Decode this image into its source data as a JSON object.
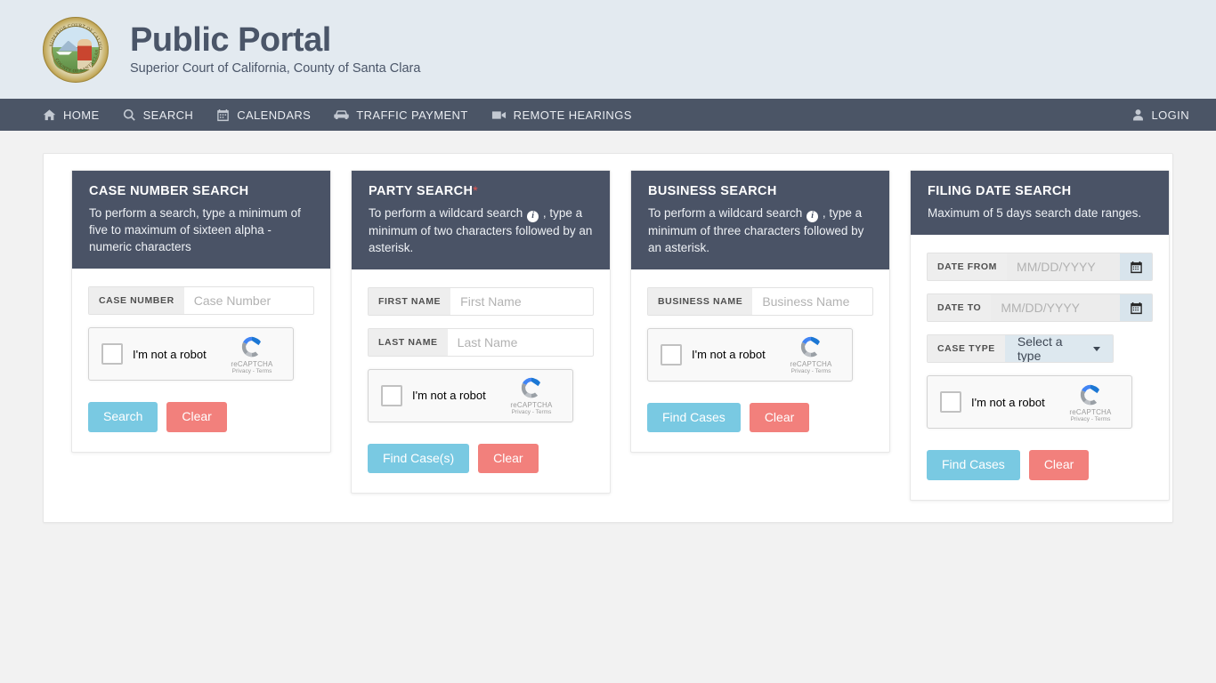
{
  "header": {
    "logo_alt": "court-seal",
    "title": "Public Portal",
    "subtitle": "Superior Court of California, County of Santa Clara",
    "background_color": "#e3eaf0",
    "title_color": "#4a5568"
  },
  "navbar": {
    "background_color": "#4b5566",
    "items": [
      {
        "label": "HOME",
        "icon": "home-icon"
      },
      {
        "label": "SEARCH",
        "icon": "search-icon"
      },
      {
        "label": "CALENDARS",
        "icon": "calendar-icon"
      },
      {
        "label": "TRAFFIC PAYMENT",
        "icon": "car-icon"
      },
      {
        "label": "REMOTE HEARINGS",
        "icon": "video-camera-icon"
      }
    ],
    "login": {
      "label": "LOGIN",
      "icon": "user-icon"
    }
  },
  "recaptcha": {
    "checkbox_label": "I'm not a robot",
    "brand": "reCAPTCHA",
    "legal": "Privacy - Terms"
  },
  "colors": {
    "card_header": "#4a5366",
    "primary_button": "#79c9e2",
    "clear_button": "#f2807c",
    "page_background": "#f2f2f2"
  },
  "cards": {
    "case_number": {
      "title": "CASE NUMBER SEARCH",
      "description": "To perform a search, type a minimum of five to maximum of sixteen alpha - numeric characters",
      "field_label": "CASE NUMBER",
      "field_placeholder": "Case Number",
      "field_value": "",
      "submit_label": "Search",
      "clear_label": "Clear"
    },
    "party": {
      "title": "PARTY SEARCH",
      "required_marker": "*",
      "description_before": "To perform a wildcard search",
      "description_after": ", type a minimum of two characters followed by an asterisk.",
      "info_icon_char": "i",
      "first_name_label": "FIRST NAME",
      "first_name_placeholder": "First Name",
      "first_name_value": "",
      "last_name_label": "LAST NAME",
      "last_name_placeholder": "Last Name",
      "last_name_value": "",
      "submit_label": "Find Case(s)",
      "clear_label": "Clear"
    },
    "business": {
      "title": "BUSINESS SEARCH",
      "description_before": "To perform a wildcard search",
      "description_after": ", type a minimum of three characters followed by an asterisk.",
      "info_icon_char": "i",
      "field_label": "BUSINESS NAME",
      "field_placeholder": "Business Name",
      "field_value": "",
      "submit_label": "Find Cases",
      "clear_label": "Clear"
    },
    "filing_date": {
      "title": "FILING DATE SEARCH",
      "description": "Maximum of 5 days search date ranges.",
      "date_from_label": "DATE FROM",
      "date_from_placeholder": "MM/DD/YYYY",
      "date_from_value": "",
      "date_to_label": "DATE TO",
      "date_to_placeholder": "MM/DD/YYYY",
      "date_to_value": "",
      "case_type_label": "CASE TYPE",
      "case_type_selected": "Select a type",
      "submit_label": "Find Cases",
      "clear_label": "Clear"
    }
  }
}
